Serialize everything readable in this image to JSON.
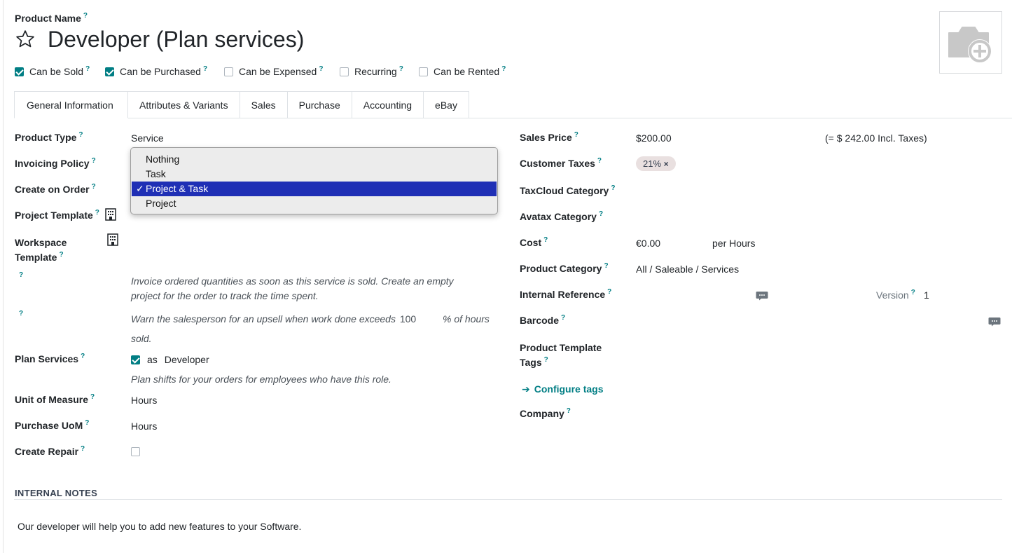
{
  "header": {
    "product_name_label": "Product Name",
    "help": "?",
    "title": "Developer (Plan services)",
    "checks": [
      {
        "label": "Can be Sold",
        "checked": true
      },
      {
        "label": "Can be Purchased",
        "checked": true
      },
      {
        "label": "Can be Expensed",
        "checked": false
      },
      {
        "label": "Recurring",
        "checked": false
      },
      {
        "label": "Can be Rented",
        "checked": false
      }
    ]
  },
  "tabs": [
    "General Information",
    "Attributes & Variants",
    "Sales",
    "Purchase",
    "Accounting",
    "eBay"
  ],
  "left": {
    "product_type_label": "Product Type",
    "product_type_value": "Service",
    "invoicing_policy_label": "Invoicing Policy",
    "create_on_order_label": "Create on Order",
    "project_template_label": "Project Template",
    "workspace_label_1": "Workspace",
    "workspace_label_2": "Template",
    "invoice_note": "Invoice ordered quantities as soon as this service is sold. Create an empty",
    "invoice_note_2": "project for the order to track the time spent.",
    "warn_note": "Warn the salesperson for an upsell when work done exceeds",
    "warn_value": "100",
    "warn_unit": "% of hours",
    "warn_note_2": "sold.",
    "plan_services_label": "Plan Services",
    "plan_as": "as",
    "plan_role": "Developer",
    "plan_note": "Plan shifts for your orders for employees who have this role.",
    "uom_label": "Unit of Measure",
    "uom_value": "Hours",
    "purchase_uom_label": "Purchase UoM",
    "purchase_uom_value": "Hours",
    "create_repair_label": "Create Repair"
  },
  "dropdown": {
    "options": [
      "Nothing",
      "Task",
      "Project & Task",
      "Project"
    ],
    "selected": "Project & Task",
    "tick": "✓",
    "selected_color": "#1f2fb5"
  },
  "right": {
    "sales_price_label": "Sales Price",
    "sales_price_value": "$200.00",
    "incl_taxes": "(= $ 242.00 Incl. Taxes)",
    "customer_taxes_label": "Customer Taxes",
    "tax_tag": "21%",
    "tag_remove": "×",
    "taxcloud_label": "TaxCloud Category",
    "avatax_label": "Avatax Category",
    "cost_label": "Cost",
    "cost_value": "€0.00",
    "cost_unit": "per Hours",
    "category_label": "Product Category",
    "category_value": "All / Saleable / Services",
    "internal_ref_label": "Internal Reference",
    "version_label": "Version",
    "version_value": "1",
    "barcode_label": "Barcode",
    "tags_label_1": "Product Template",
    "tags_label_2": "Tags",
    "configure_tags": "Configure tags",
    "arrow": "➔",
    "company_label": "Company"
  },
  "notes": {
    "title": "INTERNAL NOTES",
    "text": "Our developer will help you to add new features to your Software."
  },
  "colors": {
    "accent": "#017e84",
    "tag_bg": "#e9e0e0"
  }
}
